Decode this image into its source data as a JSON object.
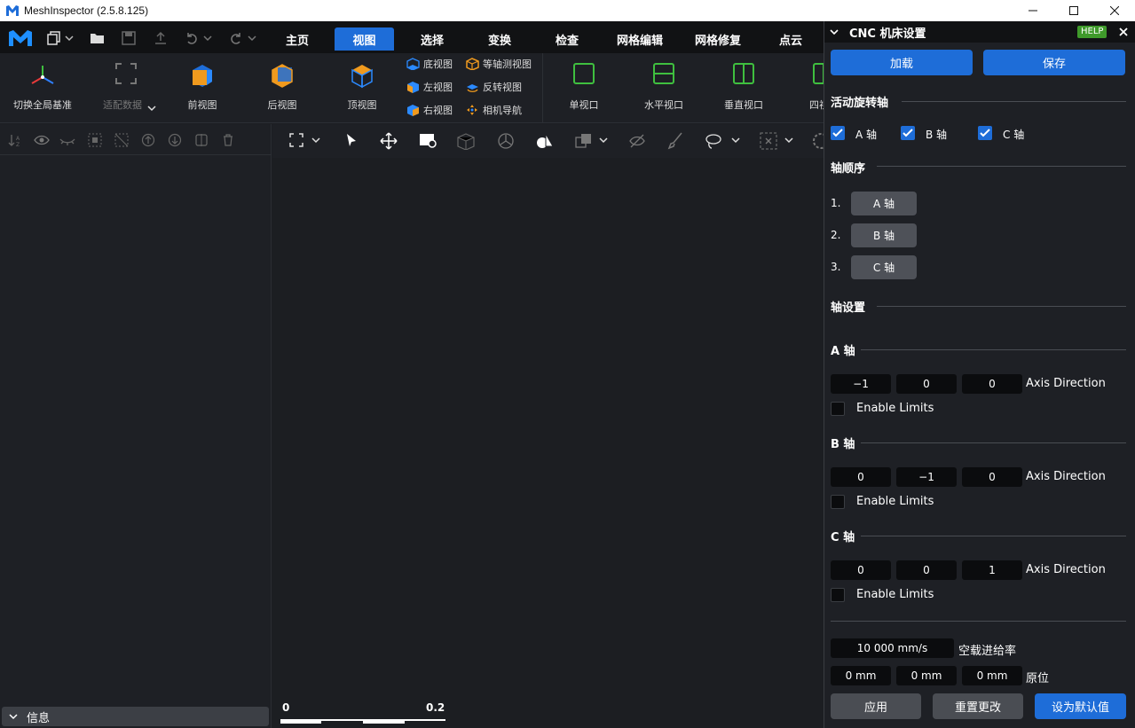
{
  "window": {
    "title": "MeshInspector (2.5.8.125)"
  },
  "tabs": [
    {
      "label": "主页"
    },
    {
      "label": "视图"
    },
    {
      "label": "选择"
    },
    {
      "label": "变换"
    },
    {
      "label": "检查"
    },
    {
      "label": "网格编辑"
    },
    {
      "label": "网格修复"
    },
    {
      "label": "点云"
    }
  ],
  "ribbon": {
    "global_basis": "切换全局基准",
    "fit_data": "适配数据",
    "front_view": "前视图",
    "back_view": "后视图",
    "top_view": "顶视图",
    "bottom_view": "底视图",
    "left_view": "左视图",
    "right_view": "右视图",
    "iso_view": "等轴测视图",
    "flip_view": "反转视图",
    "camera_nav": "相机导航",
    "single_viewport": "单视口",
    "horiz_viewport": "水平视口",
    "vert_viewport": "垂直视口",
    "quad_viewport": "四视口"
  },
  "left_panel": {
    "info_label": "信息"
  },
  "scale_bar": {
    "min": "0",
    "max": "0.2"
  },
  "colors": {
    "accent": "#1e6dd8",
    "bg": "#1e2025",
    "help": "#3f9a2b",
    "viewport_icon": "#3fbf3f",
    "cube_orange": "#f09a1e",
    "cube_blue": "#1e6dd8"
  },
  "cnc": {
    "title": "CNC 机床设置",
    "help": "HELP",
    "load": "加载",
    "save": "保存",
    "active_axes_title": "活动旋转轴",
    "active_axes": [
      {
        "label": "A 轴",
        "checked": true
      },
      {
        "label": "B 轴",
        "checked": true
      },
      {
        "label": "C 轴",
        "checked": true
      }
    ],
    "axis_order_title": "轴顺序",
    "axis_order": [
      {
        "num": "1.",
        "label": "A 轴"
      },
      {
        "num": "2.",
        "label": "B 轴"
      },
      {
        "num": "3.",
        "label": "C 轴"
      }
    ],
    "axis_settings_title": "轴设置",
    "axes": [
      {
        "name": "A 轴",
        "direction": [
          "−1",
          "0",
          "0"
        ],
        "dir_label": "Axis Direction",
        "limits_label": "Enable Limits",
        "limits": false
      },
      {
        "name": "B 轴",
        "direction": [
          "0",
          "−1",
          "0"
        ],
        "dir_label": "Axis Direction",
        "limits_label": "Enable Limits",
        "limits": false
      },
      {
        "name": "C 轴",
        "direction": [
          "0",
          "0",
          "1"
        ],
        "dir_label": "Axis Direction",
        "limits_label": "Enable Limits",
        "limits": false
      }
    ],
    "feed_rate": "10 000 mm/s",
    "feed_rate_label": "空载进给率",
    "home": [
      "0 mm",
      "0 mm",
      "0 mm"
    ],
    "home_label": "原位",
    "apply": "应用",
    "reset": "重置更改",
    "set_default": "设为默认值"
  }
}
